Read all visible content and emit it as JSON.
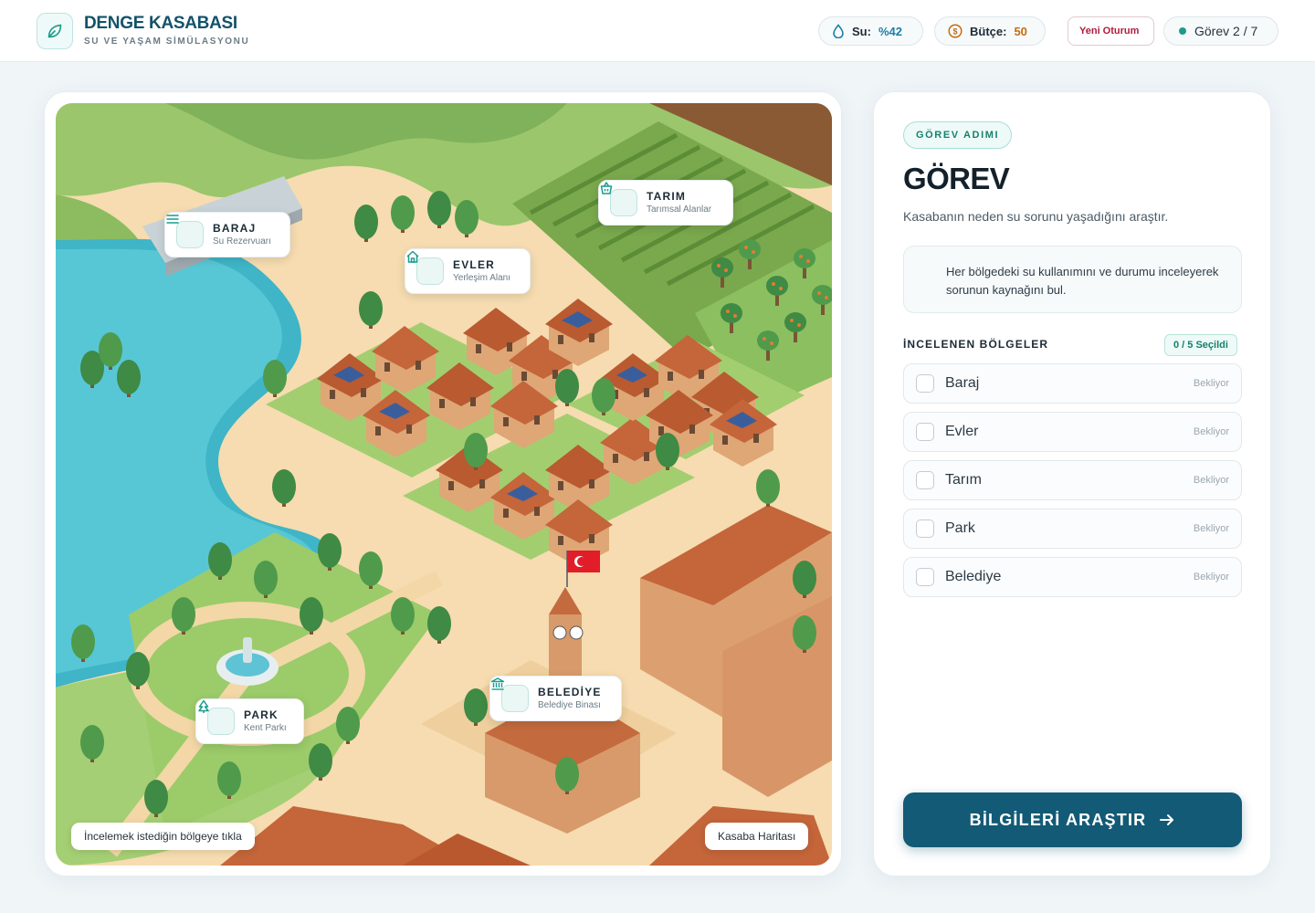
{
  "brand": {
    "title": "DENGE KASABASI",
    "subtitle": "SU VE YAŞAM SİMÜLASYONU",
    "logo_icon": "leaf-icon"
  },
  "header": {
    "water": {
      "label": "Su:",
      "value": "%42",
      "icon": "water-drop-icon"
    },
    "budget": {
      "label": "Bütçe:",
      "value": "50",
      "icon": "coin-icon"
    },
    "new_session": "Yeni Oturum",
    "task_progress": "Görev 2 / 7"
  },
  "map": {
    "pois": [
      {
        "title": "BARAJ",
        "subtitle": "Su Rezervuarı",
        "icon": "dam-icon"
      },
      {
        "title": "EVLER",
        "subtitle": "Yerleşim Alanı",
        "icon": "house-icon"
      },
      {
        "title": "TARIM",
        "subtitle": "Tarımsal Alanlar",
        "icon": "basket-icon"
      },
      {
        "title": "PARK",
        "subtitle": "Kent Parkı",
        "icon": "tree-icon"
      },
      {
        "title": "BELEDİYE",
        "subtitle": "Belediye Binası",
        "icon": "building-icon"
      }
    ],
    "hint": "İncelemek istediğin bölgeye tıkla",
    "caption": "Kasaba Haritası"
  },
  "panel": {
    "step_badge": "GÖREV ADIMI",
    "title": "GÖREV",
    "description": "Kasabanın neden su sorunu yaşadığını araştır.",
    "hint": "Her bölgedeki su kullanımını ve durumu inceleyerek sorunun kaynağını bul.",
    "regions_title": "İNCELENEN BÖLGELER",
    "regions_count": "0 / 5 Seçildi",
    "regions": [
      {
        "name": "Baraj",
        "status": "Bekliyor"
      },
      {
        "name": "Evler",
        "status": "Bekliyor"
      },
      {
        "name": "Tarım",
        "status": "Bekliyor"
      },
      {
        "name": "Park",
        "status": "Bekliyor"
      },
      {
        "name": "Belediye",
        "status": "Bekliyor"
      }
    ],
    "action_button": "BİLGİLERİ ARAŞTIR"
  },
  "colors": {
    "primary": "#135a76",
    "accent": "#1a9c8c",
    "budget": "#c76b10",
    "water": "#1b7fa8",
    "danger": "#b01b3c"
  }
}
